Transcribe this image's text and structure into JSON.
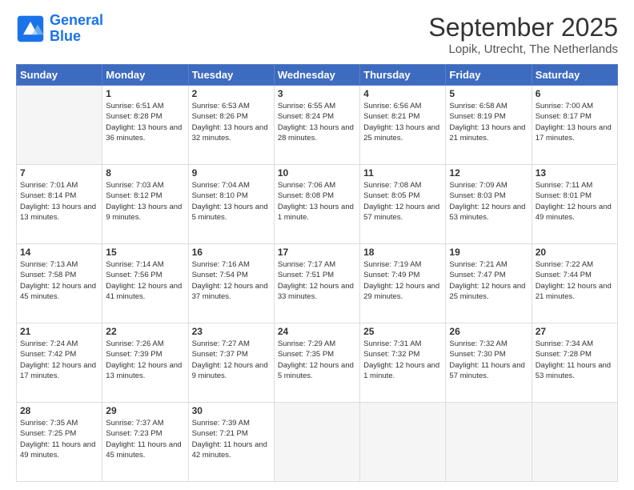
{
  "logo": {
    "line1": "General",
    "line2": "Blue"
  },
  "header": {
    "title": "September 2025",
    "subtitle": "Lopik, Utrecht, The Netherlands"
  },
  "weekdays": [
    "Sunday",
    "Monday",
    "Tuesday",
    "Wednesday",
    "Thursday",
    "Friday",
    "Saturday"
  ],
  "weeks": [
    [
      {
        "day": "",
        "sunrise": "",
        "sunset": "",
        "daylight": ""
      },
      {
        "day": "1",
        "sunrise": "6:51 AM",
        "sunset": "8:28 PM",
        "daylight": "13 hours and 36 minutes."
      },
      {
        "day": "2",
        "sunrise": "6:53 AM",
        "sunset": "8:26 PM",
        "daylight": "13 hours and 32 minutes."
      },
      {
        "day": "3",
        "sunrise": "6:55 AM",
        "sunset": "8:24 PM",
        "daylight": "13 hours and 28 minutes."
      },
      {
        "day": "4",
        "sunrise": "6:56 AM",
        "sunset": "8:21 PM",
        "daylight": "13 hours and 25 minutes."
      },
      {
        "day": "5",
        "sunrise": "6:58 AM",
        "sunset": "8:19 PM",
        "daylight": "13 hours and 21 minutes."
      },
      {
        "day": "6",
        "sunrise": "7:00 AM",
        "sunset": "8:17 PM",
        "daylight": "13 hours and 17 minutes."
      }
    ],
    [
      {
        "day": "7",
        "sunrise": "7:01 AM",
        "sunset": "8:14 PM",
        "daylight": "13 hours and 13 minutes."
      },
      {
        "day": "8",
        "sunrise": "7:03 AM",
        "sunset": "8:12 PM",
        "daylight": "13 hours and 9 minutes."
      },
      {
        "day": "9",
        "sunrise": "7:04 AM",
        "sunset": "8:10 PM",
        "daylight": "13 hours and 5 minutes."
      },
      {
        "day": "10",
        "sunrise": "7:06 AM",
        "sunset": "8:08 PM",
        "daylight": "13 hours and 1 minute."
      },
      {
        "day": "11",
        "sunrise": "7:08 AM",
        "sunset": "8:05 PM",
        "daylight": "12 hours and 57 minutes."
      },
      {
        "day": "12",
        "sunrise": "7:09 AM",
        "sunset": "8:03 PM",
        "daylight": "12 hours and 53 minutes."
      },
      {
        "day": "13",
        "sunrise": "7:11 AM",
        "sunset": "8:01 PM",
        "daylight": "12 hours and 49 minutes."
      }
    ],
    [
      {
        "day": "14",
        "sunrise": "7:13 AM",
        "sunset": "7:58 PM",
        "daylight": "12 hours and 45 minutes."
      },
      {
        "day": "15",
        "sunrise": "7:14 AM",
        "sunset": "7:56 PM",
        "daylight": "12 hours and 41 minutes."
      },
      {
        "day": "16",
        "sunrise": "7:16 AM",
        "sunset": "7:54 PM",
        "daylight": "12 hours and 37 minutes."
      },
      {
        "day": "17",
        "sunrise": "7:17 AM",
        "sunset": "7:51 PM",
        "daylight": "12 hours and 33 minutes."
      },
      {
        "day": "18",
        "sunrise": "7:19 AM",
        "sunset": "7:49 PM",
        "daylight": "12 hours and 29 minutes."
      },
      {
        "day": "19",
        "sunrise": "7:21 AM",
        "sunset": "7:47 PM",
        "daylight": "12 hours and 25 minutes."
      },
      {
        "day": "20",
        "sunrise": "7:22 AM",
        "sunset": "7:44 PM",
        "daylight": "12 hours and 21 minutes."
      }
    ],
    [
      {
        "day": "21",
        "sunrise": "7:24 AM",
        "sunset": "7:42 PM",
        "daylight": "12 hours and 17 minutes."
      },
      {
        "day": "22",
        "sunrise": "7:26 AM",
        "sunset": "7:39 PM",
        "daylight": "12 hours and 13 minutes."
      },
      {
        "day": "23",
        "sunrise": "7:27 AM",
        "sunset": "7:37 PM",
        "daylight": "12 hours and 9 minutes."
      },
      {
        "day": "24",
        "sunrise": "7:29 AM",
        "sunset": "7:35 PM",
        "daylight": "12 hours and 5 minutes."
      },
      {
        "day": "25",
        "sunrise": "7:31 AM",
        "sunset": "7:32 PM",
        "daylight": "12 hours and 1 minute."
      },
      {
        "day": "26",
        "sunrise": "7:32 AM",
        "sunset": "7:30 PM",
        "daylight": "11 hours and 57 minutes."
      },
      {
        "day": "27",
        "sunrise": "7:34 AM",
        "sunset": "7:28 PM",
        "daylight": "11 hours and 53 minutes."
      }
    ],
    [
      {
        "day": "28",
        "sunrise": "7:35 AM",
        "sunset": "7:25 PM",
        "daylight": "11 hours and 49 minutes."
      },
      {
        "day": "29",
        "sunrise": "7:37 AM",
        "sunset": "7:23 PM",
        "daylight": "11 hours and 45 minutes."
      },
      {
        "day": "30",
        "sunrise": "7:39 AM",
        "sunset": "7:21 PM",
        "daylight": "11 hours and 42 minutes."
      },
      {
        "day": "",
        "sunrise": "",
        "sunset": "",
        "daylight": ""
      },
      {
        "day": "",
        "sunrise": "",
        "sunset": "",
        "daylight": ""
      },
      {
        "day": "",
        "sunrise": "",
        "sunset": "",
        "daylight": ""
      },
      {
        "day": "",
        "sunrise": "",
        "sunset": "",
        "daylight": ""
      }
    ]
  ]
}
